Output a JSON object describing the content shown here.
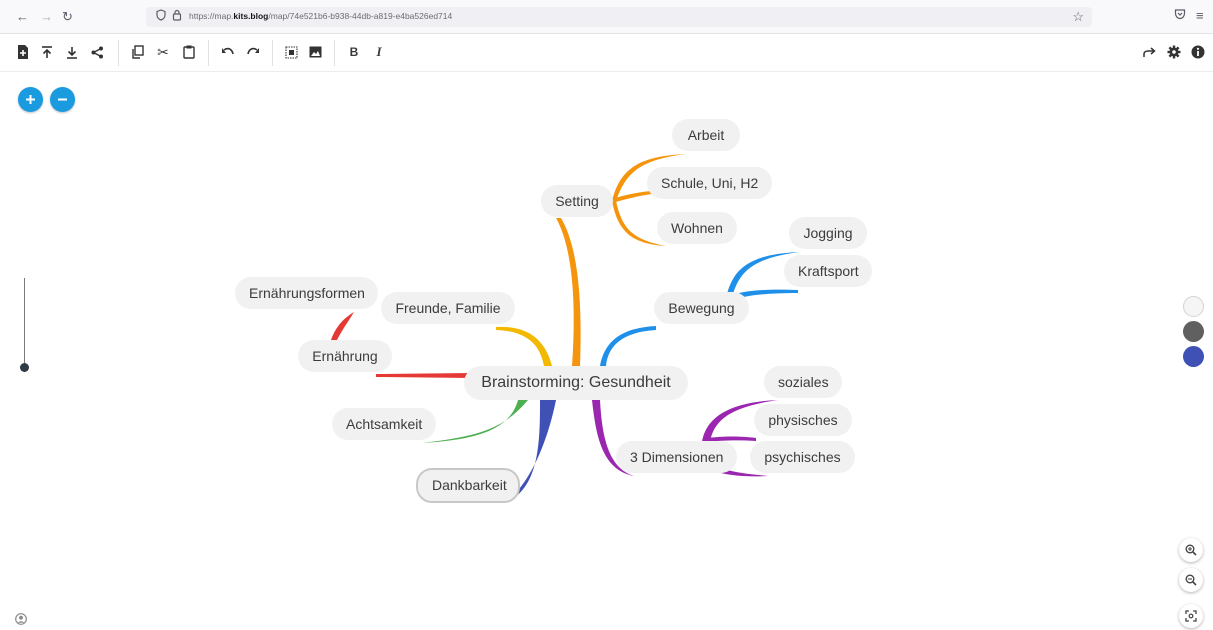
{
  "browser": {
    "url_prefix": "https://map.",
    "url_domain": "kits.blog",
    "url_path": "/map/74e521b6-b938-44db-a819-e4ba526ed714"
  },
  "colors": {
    "accent": "#1a9be0",
    "branch_orange": "#f5940d",
    "branch_blue": "#1e90ea",
    "branch_purple": "#9b27b0",
    "branch_indigo": "#3f51b5",
    "branch_green": "#4caf50",
    "branch_red": "#e53935",
    "branch_yellow": "#f3b800",
    "swatch_white": "#f5f5f5",
    "swatch_gray": "#606060",
    "swatch_blue": "#3f51b5"
  },
  "mindmap": {
    "central": "Brainstorming: Gesundheit",
    "setting": "Setting",
    "setting_children": [
      "Arbeit",
      "Schule, Uni, H2",
      "Wohnen"
    ],
    "bewegung": "Bewegung",
    "bewegung_children": [
      "Jogging",
      "Kraftsport"
    ],
    "dimensionen": "3 Dimensionen",
    "dimensionen_children": [
      "soziales",
      "physisches",
      "psychisches"
    ],
    "dankbarkeit": "Dankbarkeit",
    "achtsamkeit": "Achtsamkeit",
    "ernaehrung": "Ernährung",
    "ernaehrung_children": [
      "Ernährungsformen"
    ],
    "freunde": "Freunde, Familie"
  }
}
